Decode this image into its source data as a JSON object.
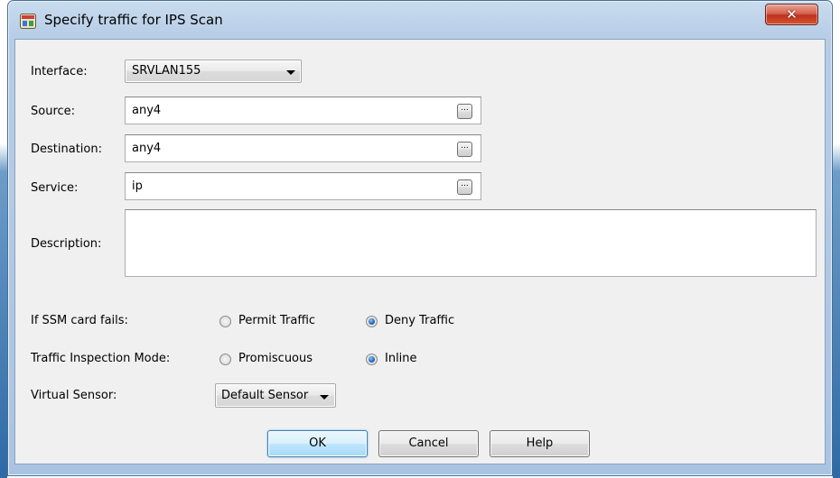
{
  "window": {
    "title": "Specify traffic for IPS Scan",
    "close_icon": "close-x-icon",
    "title_icon": "ips-app-icon"
  },
  "interface": {
    "label": "Interface:",
    "value": "SRVLAN155"
  },
  "source": {
    "label": "Source:",
    "value": "any4",
    "browse_label": "..."
  },
  "destination": {
    "label": "Destination:",
    "value": "any4",
    "browse_label": "..."
  },
  "service": {
    "label": "Service:",
    "value": "ip",
    "browse_label": "..."
  },
  "description": {
    "label": "Description:",
    "value": ""
  },
  "ssm_fail": {
    "label": "If SSM card fails:",
    "options": [
      {
        "label": "Permit Traffic",
        "checked": false
      },
      {
        "label": "Deny Traffic",
        "checked": true
      }
    ]
  },
  "inspection_mode": {
    "label": "Traffic Inspection Mode:",
    "options": [
      {
        "label": "Promiscuous",
        "checked": false
      },
      {
        "label": "Inline",
        "checked": true
      }
    ]
  },
  "virtual_sensor": {
    "label": "Virtual Sensor:",
    "value": "Default Sensor"
  },
  "buttons": {
    "ok": "OK",
    "cancel": "Cancel",
    "help": "Help"
  },
  "colors": {
    "title_bar": "#b7cde6",
    "client_bg": "#f0f0f0",
    "close_button": "#c0311d",
    "default_button": "#a7d9f5",
    "radio_selected": "#1e63b8"
  }
}
